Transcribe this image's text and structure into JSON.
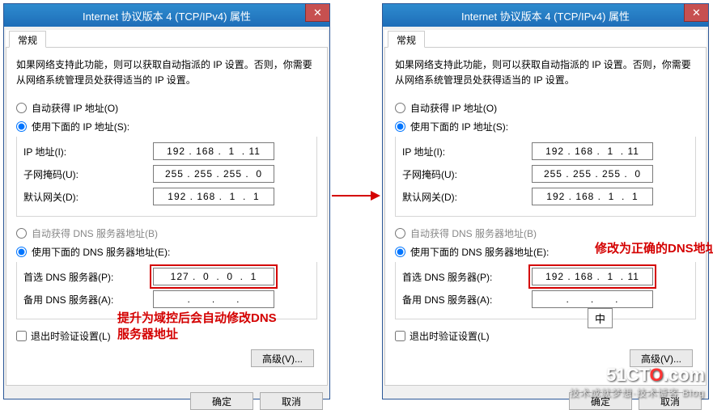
{
  "dialog": {
    "title": "Internet 协议版本 4 (TCP/IPv4) 属性",
    "close": "✕"
  },
  "tabs": {
    "general": "常规"
  },
  "desc": "如果网络支持此功能，则可以获取自动指派的 IP 设置。否则，你需要从网络系统管理员处获得适当的 IP 设置。",
  "ip": {
    "autoLabel": "自动获得 IP 地址(O)",
    "manualLabel": "使用下面的 IP 地址(S):",
    "addrLabel": "IP 地址(I):",
    "maskLabel": "子网掩码(U):",
    "gwLabel": "默认网关(D):",
    "addr": "192 . 168 .  1  . 11",
    "mask": "255 . 255 . 255 .  0",
    "gw": "192 . 168 .  1  .  1"
  },
  "dns": {
    "autoLabel": "自动获得 DNS 服务器地址(B)",
    "manualLabel": "使用下面的 DNS 服务器地址(E):",
    "primaryLabel": "首选 DNS 服务器(P):",
    "altLabel": "备用 DNS 服务器(A):",
    "left_primary": "127 .  0  .  0  .  1",
    "left_alt": "     .      .      .     ",
    "right_primary": "192 . 168 .  1  . 11",
    "right_alt": "     .      .      .     "
  },
  "bottom": {
    "validateChk": "退出时验证设置(L)",
    "advanced": "高级(V)...",
    "ok": "确定",
    "cancel": "取消"
  },
  "annotations": {
    "leftNote": "提升为域控后会自动修改DNS服务器地址",
    "rightNote": "修改为正确的DNS地址",
    "imeCandidate": "中"
  },
  "watermark": {
    "line1a": "51CT",
    "line1o": "O",
    "line1b": ".com",
    "line2": "技术成就梦想·技术博客 Blog"
  }
}
